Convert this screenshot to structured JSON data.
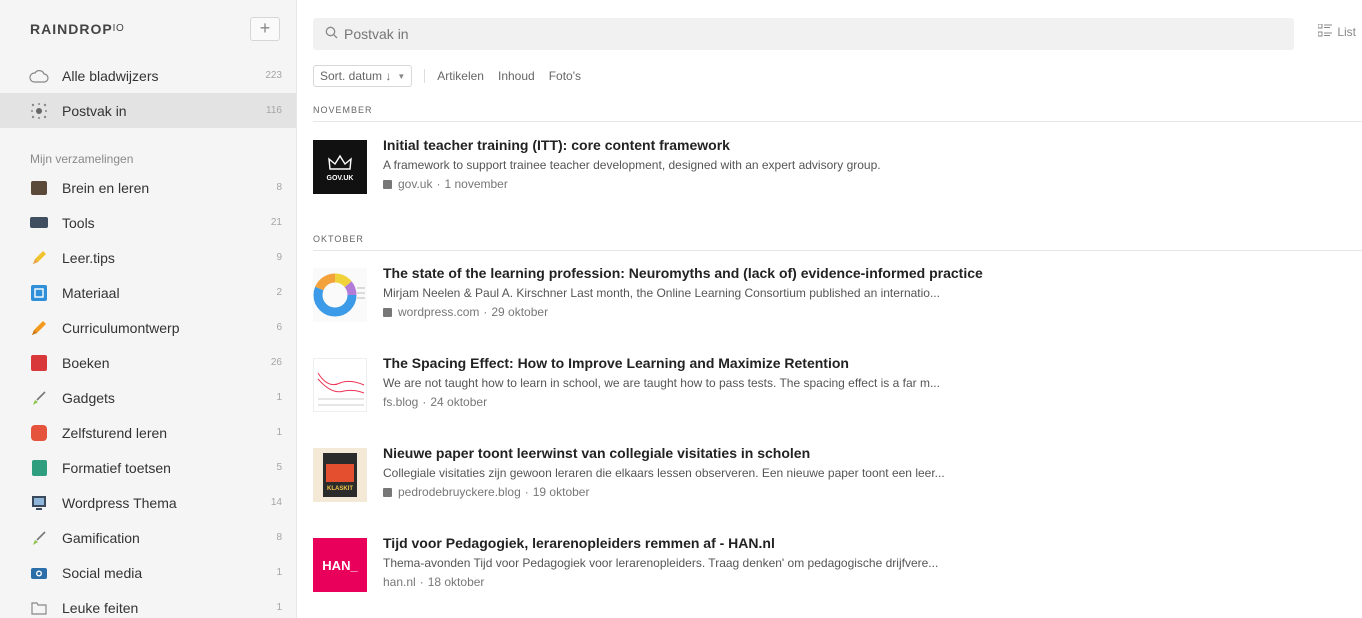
{
  "app": {
    "brand": "RAINDROP",
    "brand_suffix": "IO",
    "add_label": "+"
  },
  "sidebar": {
    "top_items": [
      {
        "label": "Alle bladwijzers",
        "count": "223",
        "icon": "cloud-icon"
      },
      {
        "label": "Postvak in",
        "count": "116",
        "icon": "inbox-icon"
      }
    ],
    "section_title": "Mijn verzamelingen",
    "collections": [
      {
        "label": "Brein en leren",
        "count": "8",
        "icon": "brain-icon"
      },
      {
        "label": "Tools",
        "count": "21",
        "icon": "laptop-icon"
      },
      {
        "label": "Leer.tips",
        "count": "9",
        "icon": "pencil-icon"
      },
      {
        "label": "Materiaal",
        "count": "2",
        "icon": "document-icon"
      },
      {
        "label": "Curriculumontwerp",
        "count": "6",
        "icon": "pen-icon"
      },
      {
        "label": "Boeken",
        "count": "26",
        "icon": "book-icon"
      },
      {
        "label": "Gadgets",
        "count": "1",
        "icon": "brush-icon"
      },
      {
        "label": "Zelfsturend leren",
        "count": "1",
        "icon": "group-icon"
      },
      {
        "label": "Formatief toetsen",
        "count": "5",
        "icon": "scroll-icon"
      },
      {
        "label": "Wordpress Thema",
        "count": "14",
        "icon": "monitor-icon"
      },
      {
        "label": "Gamification",
        "count": "8",
        "icon": "brush-icon"
      },
      {
        "label": "Social media",
        "count": "1",
        "icon": "camera-icon"
      },
      {
        "label": "Leuke feiten",
        "count": "1",
        "icon": "folder-icon"
      }
    ]
  },
  "search": {
    "placeholder": "Postvak in",
    "value": ""
  },
  "view": {
    "label": "List"
  },
  "toolbar": {
    "sort_label": "Sort. datum ↓",
    "links": [
      "Artikelen",
      "Inhoud",
      "Foto's"
    ]
  },
  "groups": [
    {
      "label": "NOVEMBER"
    },
    {
      "label": "OKTOBER"
    }
  ],
  "items": [
    {
      "title": "Initial teacher training (ITT): core content framework",
      "excerpt": "A framework to support trainee teacher development, designed with an expert advisory group.",
      "domain": "gov.uk",
      "date": "1 november",
      "favicon": true,
      "thumb": "gov-uk"
    },
    {
      "title": "The state of the learning profession: Neuromyths and (lack of) evidence-informed practice",
      "excerpt": "Mirjam Neelen & Paul A. Kirschner Last month, the Online Learning Consortium published an internatio...",
      "domain": "wordpress.com",
      "date": "29 oktober",
      "favicon": true,
      "thumb": "donut"
    },
    {
      "title": "The Spacing Effect: How to Improve Learning and Maximize Retention",
      "excerpt": "We are not taught how to learn in school, we are taught how to pass tests. The spacing effect is a far m...",
      "domain": "fs.blog",
      "date": "24 oktober",
      "favicon": false,
      "thumb": "graph"
    },
    {
      "title": "Nieuwe paper toont leerwinst van collegiale visitaties in scholen",
      "excerpt": "Collegiale visitaties zijn gewoon leraren die elkaars lessen observeren. Een nieuwe paper toont een leer...",
      "domain": "pedrodebruyckere.blog",
      "date": "19 oktober",
      "favicon": true,
      "thumb": "klaskit"
    },
    {
      "title": "Tijd voor Pedagogiek, lerarenopleiders remmen af - HAN.nl",
      "excerpt": "Thema-avonden Tijd voor Pedagogiek voor lerarenopleiders. Traag denken' om pedagogische drijfvere...",
      "domain": "han.nl",
      "date": "18 oktober",
      "favicon": false,
      "thumb": "han"
    }
  ],
  "thumb_text": {
    "gov": "GOV.UK",
    "han": "HAN_",
    "klaskit": "KLASKIT"
  },
  "colors": {
    "accent": "#e8005a",
    "sidebar_bg": "#f5f5f5"
  }
}
